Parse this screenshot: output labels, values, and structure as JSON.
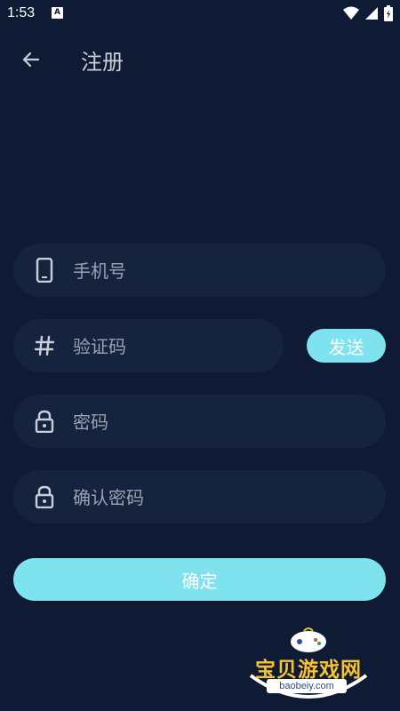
{
  "status_bar": {
    "time": "1:53",
    "notification_badge": "A",
    "icons": [
      "wifi-icon",
      "signal-icon",
      "battery-icon"
    ]
  },
  "header": {
    "title": "注册",
    "back_icon": "arrow-left-icon"
  },
  "form": {
    "phone": {
      "placeholder": "手机号",
      "icon": "phone-icon"
    },
    "code": {
      "placeholder": "验证码",
      "icon": "hash-icon"
    },
    "send_label": "发送",
    "password": {
      "placeholder": "密码",
      "icon": "lock-icon"
    },
    "confirm_password": {
      "placeholder": "确认密码",
      "icon": "lock-icon"
    },
    "submit_label": "确定"
  },
  "watermark": {
    "name": "宝贝游戏网",
    "url": "baobeiy.com"
  },
  "colors": {
    "background": "#0f1b35",
    "field": "#16233f",
    "accent": "#7fe3ef",
    "text": "#c9ced9"
  }
}
